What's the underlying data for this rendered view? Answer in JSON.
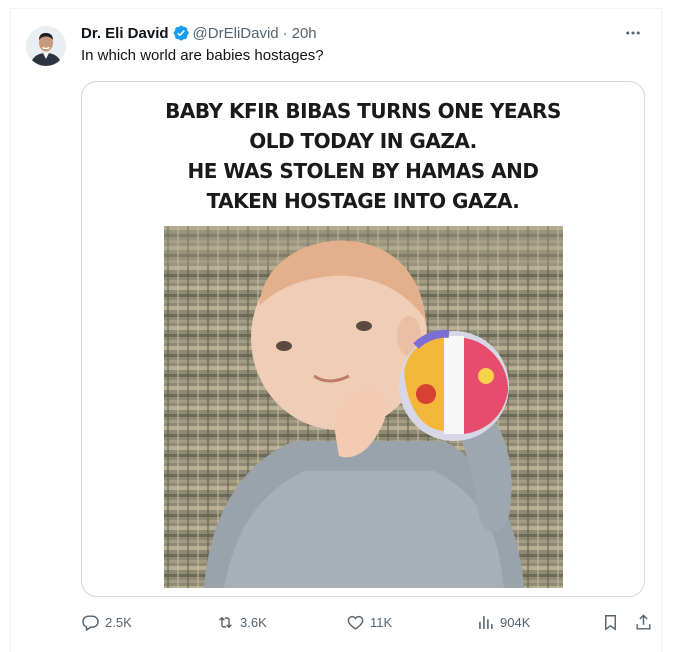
{
  "tweet": {
    "author_name": "Dr. Eli David",
    "handle": "@DrEliDavid",
    "separator": "·",
    "time": "20h",
    "more_label": "•••",
    "text": "In which world are babies hostages?",
    "media": {
      "headline_lines": [
        "BABY KFIR BIBAS TURNS ONE YEARS",
        "OLD TODAY IN GAZA.",
        "HE WAS STOLEN BY HAMAS AND",
        "TAKEN HOSTAGE INTO GAZA."
      ]
    },
    "actions": {
      "replies": "2.5K",
      "reposts": "3.6K",
      "likes": "11K",
      "views": "904K"
    }
  },
  "colors": {
    "verified": "#1d9bf0",
    "muted": "#536471",
    "text": "#0f1419",
    "border": "#cfd9de"
  },
  "icons": {
    "reply": "reply-icon",
    "repost": "repost-icon",
    "like": "heart-icon",
    "views": "views-icon",
    "bookmark": "bookmark-icon",
    "share": "share-icon",
    "verified": "verified-badge-icon"
  }
}
